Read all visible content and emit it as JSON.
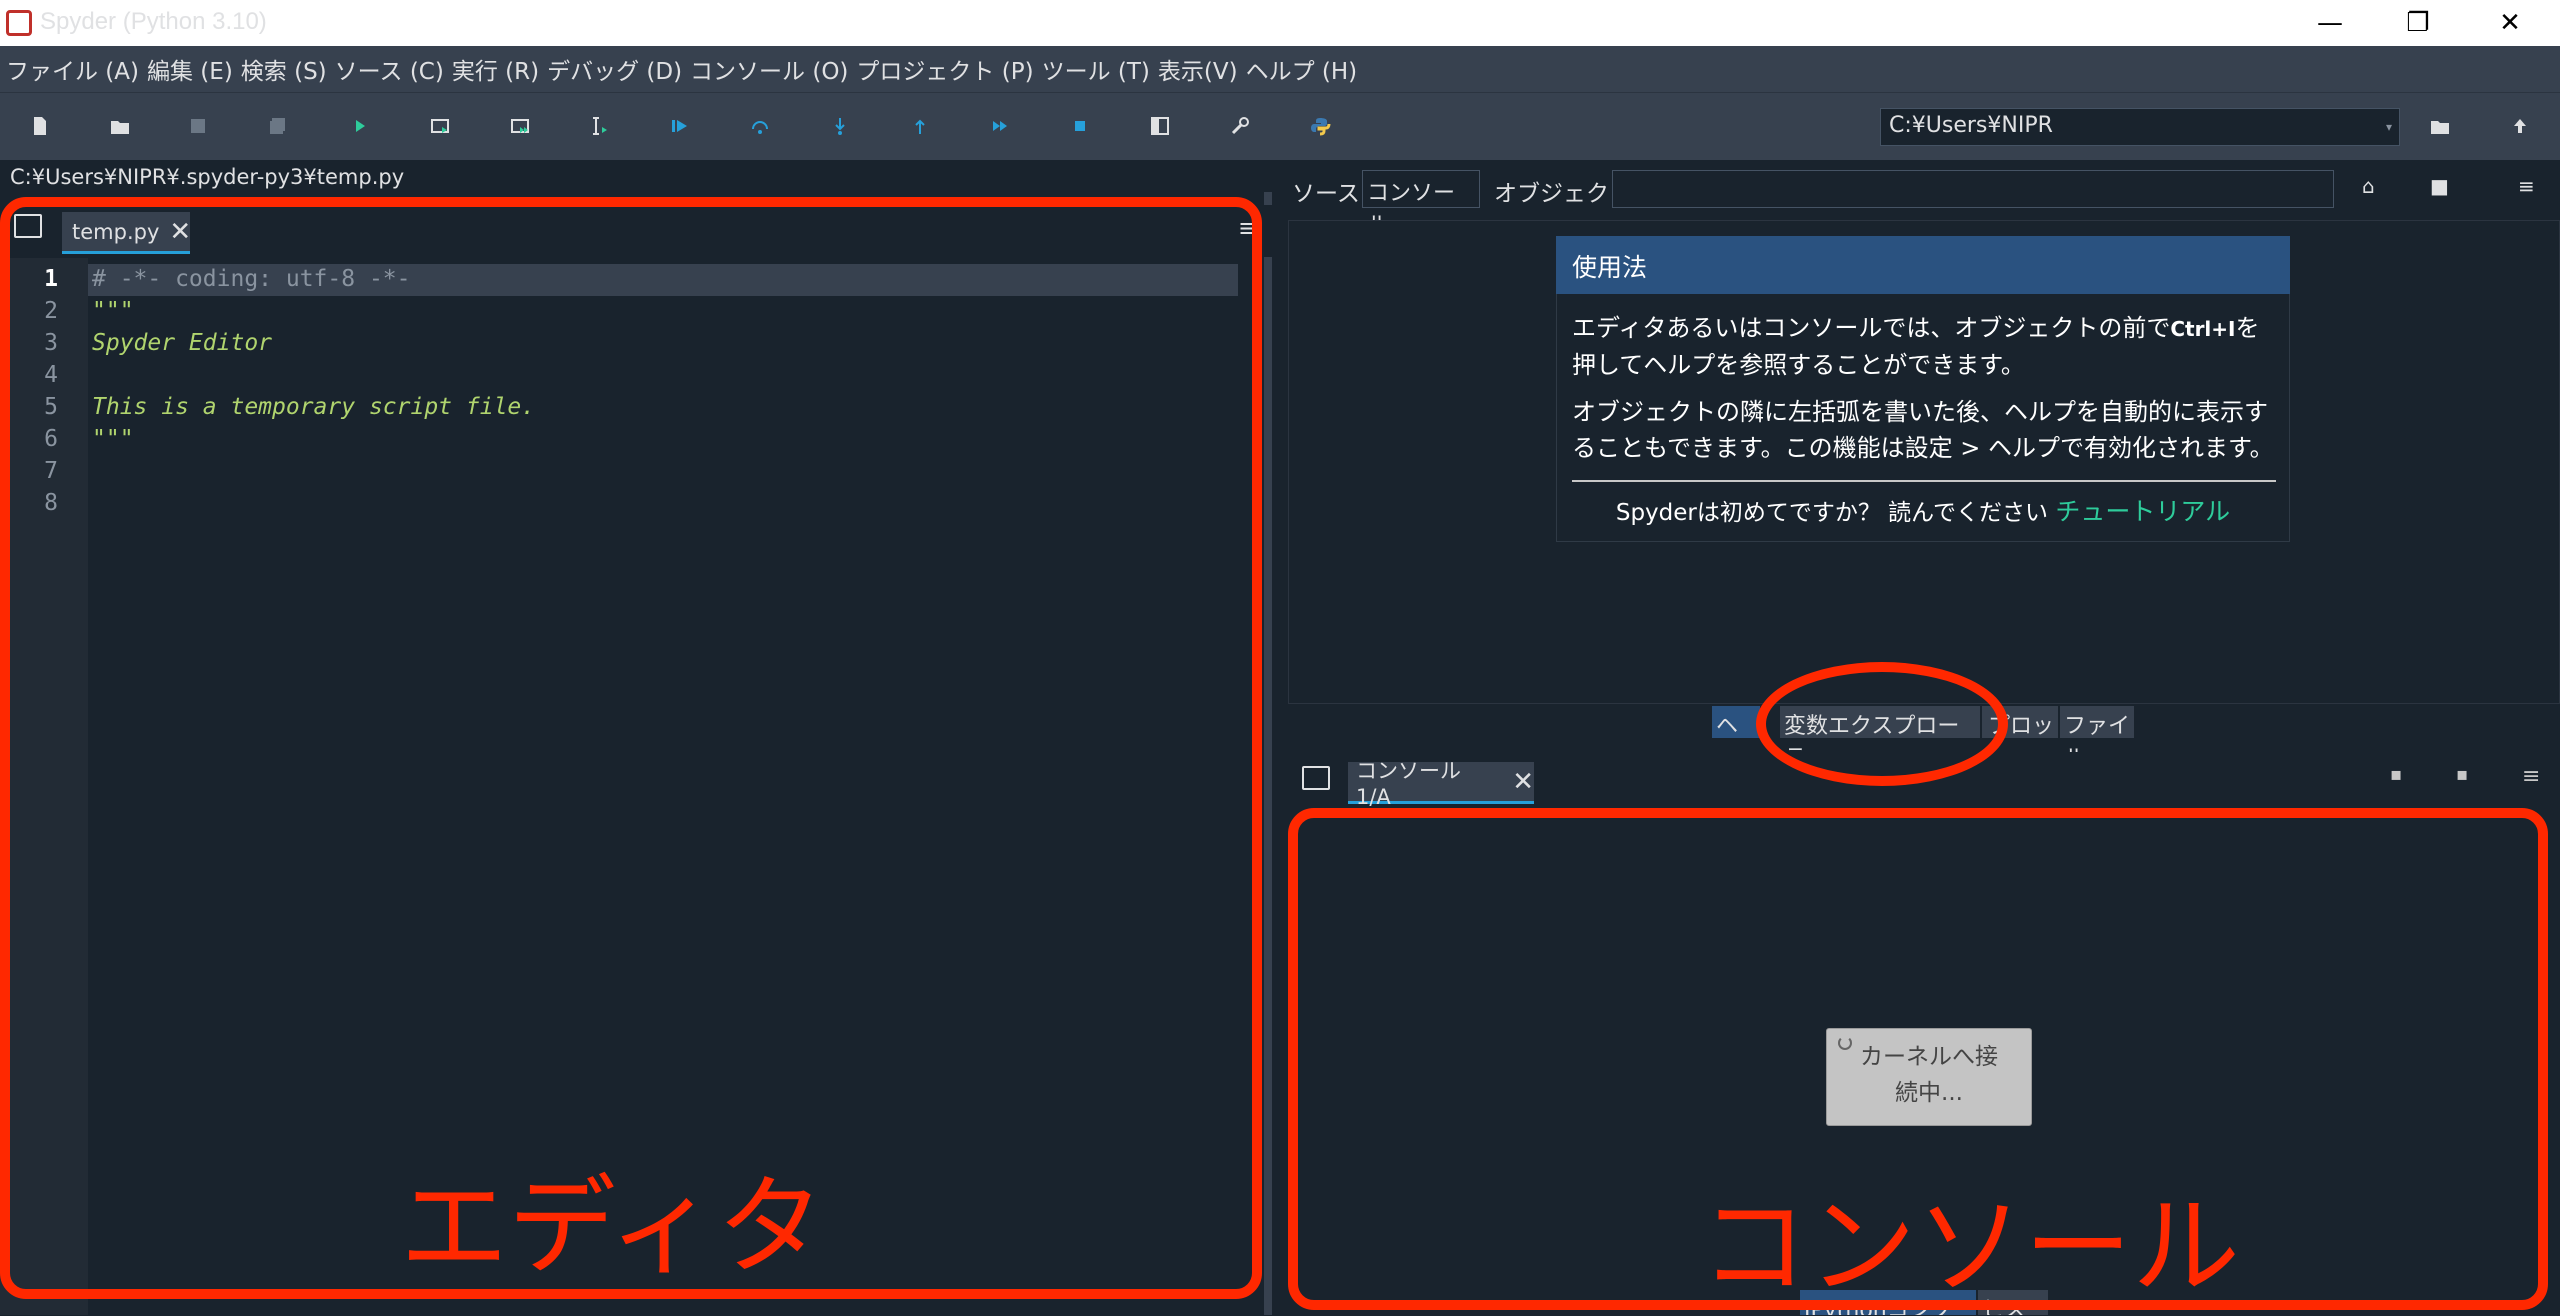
{
  "window": {
    "title": "Spyder (Python 3.10)",
    "minimize": "—",
    "restore": "❐",
    "close": "✕"
  },
  "menubar": [
    "ファイル (A)",
    "編集 (E)",
    "検索 (S)",
    "ソース (C)",
    "実行 (R)",
    "デバッグ (D)",
    "コンソール (O)",
    "プロジェクト (P)",
    "ツール (T)",
    "表示(V)",
    "ヘルプ (H)"
  ],
  "toolbar": {
    "icons": [
      "new-file-icon",
      "open-file-icon",
      "save-icon",
      "save-all-icon",
      "run-icon",
      "run-cell-icon",
      "run-cell-advance-icon",
      "run-selection-icon",
      "debug-icon",
      "step-icon",
      "step-into-icon",
      "step-return-icon",
      "continue-icon",
      "stop-icon",
      "maximize-pane-icon",
      "preferences-icon",
      "python-path-icon"
    ],
    "working_dir": "C:¥Users¥NIPR"
  },
  "editor": {
    "file_path": "C:¥Users¥NIPR¥.spyder-py3¥temp.py",
    "tab_label": "temp.py",
    "current_line": 1,
    "lines": [
      {
        "n": "1",
        "text": "# -*- coding: utf-8 -*-",
        "style": "comment"
      },
      {
        "n": "2",
        "text": "\"\"\"",
        "style": "doc"
      },
      {
        "n": "3",
        "text": "Spyder Editor",
        "style": "doc"
      },
      {
        "n": "4",
        "text": "",
        "style": "doc"
      },
      {
        "n": "5",
        "text": "This is a temporary script file.",
        "style": "doc"
      },
      {
        "n": "6",
        "text": "\"\"\"",
        "style": "doc"
      },
      {
        "n": "7",
        "text": "",
        "style": "doc"
      },
      {
        "n": "8",
        "text": "",
        "style": "doc"
      }
    ]
  },
  "help": {
    "source_label": "ソース",
    "source_value": "コンソール",
    "object_label": "オブジェクト",
    "object_value": "",
    "usage_title": "使用法",
    "usage_p1a": "エディタあるいはコンソールでは、オブジェクトの前で",
    "usage_p1_key": "Ctrl+I",
    "usage_p1b": "を押してヘルプを参照することができます。",
    "usage_p2": "オブジェクトの隣に左括弧を書いた後、ヘルプを自動的に表示することもできます。この機能は設定 > ヘルプで有効化されます。",
    "footer_text": "Spyderは初めてですか？ 読んでください",
    "footer_link": "チュートリアル"
  },
  "pane_tabs": [
    "ヘルプ",
    "変数エクスプローラー",
    "プロット",
    "ファイル"
  ],
  "console": {
    "tab_label": "コンソール 1/A",
    "connecting_text_1": "カーネルへ接",
    "connecting_text_2": "続中...",
    "bottom_tabs": [
      "IPythonコンソール",
      "ヒストリ"
    ]
  },
  "annotations": {
    "editor_label": "エディタ",
    "console_label": "コンソール",
    "color": "#ff2800"
  }
}
